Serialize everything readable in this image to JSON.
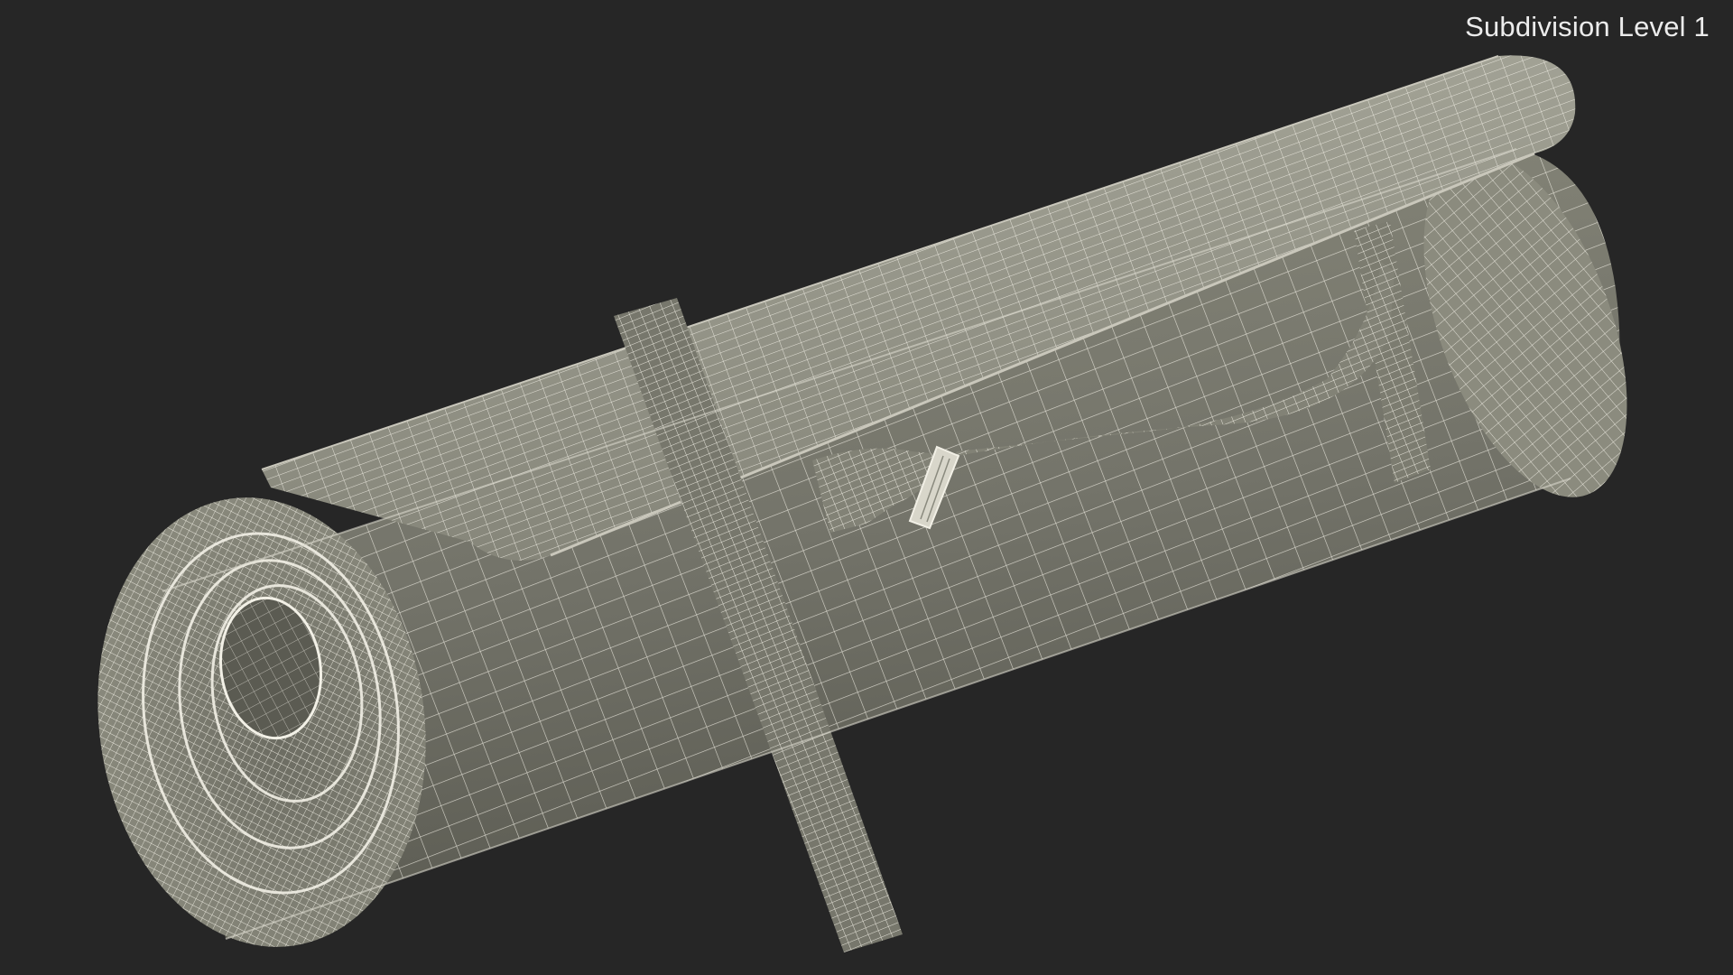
{
  "overlay": {
    "label": "Subdivision Level 1"
  },
  "scene": {
    "subject": "rolled-mat-with-strap-wireframe",
    "colors": {
      "background": "#262626",
      "surface": "#7d7d70",
      "surface_dark": "#5e5e54",
      "surface_light": "#9a9a8c",
      "wire": "#f2f0e6",
      "highlight": "#b9b9ac"
    }
  }
}
